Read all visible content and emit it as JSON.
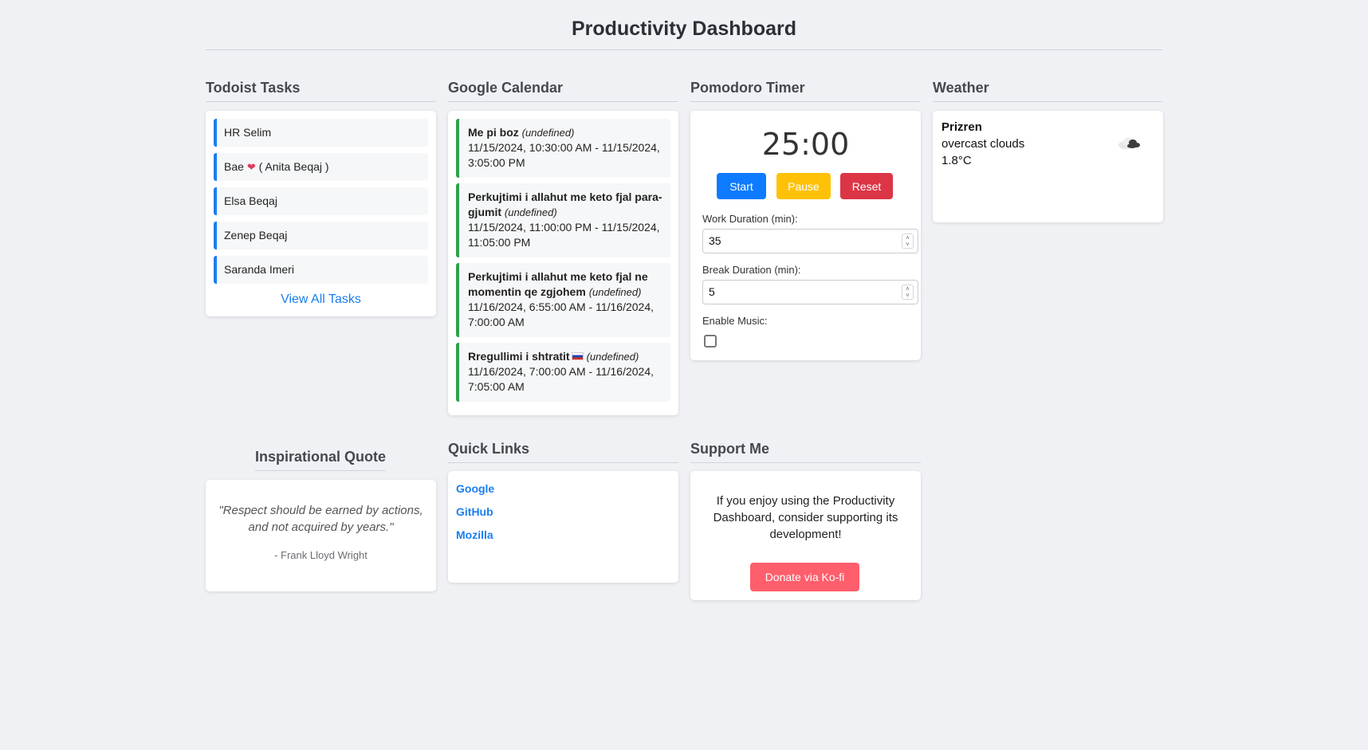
{
  "header": {
    "title": "Productivity Dashboard"
  },
  "todoist": {
    "heading": "Todoist Tasks",
    "tasks": [
      "HR Selim",
      "Bae",
      "Elsa Beqaj",
      "Zenep Beqaj",
      "Saranda Imeri"
    ],
    "task_suffix": "( Anita Beqaj )",
    "view_all": "View All Tasks"
  },
  "calendar": {
    "heading": "Google Calendar",
    "events": [
      {
        "title": "Me pi boz",
        "tag": "(undefined)",
        "time": "11/15/2024, 10:30:00 AM - 11/15/2024, 3:05:00 PM"
      },
      {
        "title": "Perkujtimi i allahut me keto fjal para-gjumit",
        "tag": "(undefined)",
        "time": "11/15/2024, 11:00:00 PM - 11/15/2024, 11:05:00 PM"
      },
      {
        "title": "Perkujtimi i allahut me keto fjal ne momentin qe zgjohem",
        "tag": "(undefined)",
        "time": "11/16/2024, 6:55:00 AM - 11/16/2024, 7:00:00 AM"
      },
      {
        "title": "Rregullimi i shtratit",
        "tag": "(undefined)",
        "time": "11/16/2024, 7:00:00 AM - 11/16/2024, 7:05:00 AM"
      }
    ]
  },
  "pomodoro": {
    "heading": "Pomodoro Timer",
    "timer": "25:00",
    "start": "Start",
    "pause": "Pause",
    "reset": "Reset",
    "work_label": "Work Duration (min):",
    "work_value": "35",
    "break_label": "Break Duration (min):",
    "break_value": "5",
    "music_label": "Enable Music:",
    "music_enabled": false,
    "colors": {
      "start": "#0d7bff",
      "pause": "#ffc107",
      "reset": "#dc3545"
    }
  },
  "weather": {
    "heading": "Weather",
    "city": "Prizren",
    "description": "overcast clouds",
    "temperature": "1.8°C",
    "icon": "cloud-icon"
  },
  "quote": {
    "heading": "Inspirational Quote",
    "text": "\"Respect should be earned by actions, and not acquired by years.\"",
    "author": "- Frank Lloyd Wright"
  },
  "quick_links": {
    "heading": "Quick Links",
    "links": [
      "Google",
      "GitHub",
      "Mozilla"
    ]
  },
  "support": {
    "heading": "Support Me",
    "text": "If you enjoy using the Productivity Dashboard, consider supporting its development!",
    "donate": "Donate via Ko-fi"
  }
}
